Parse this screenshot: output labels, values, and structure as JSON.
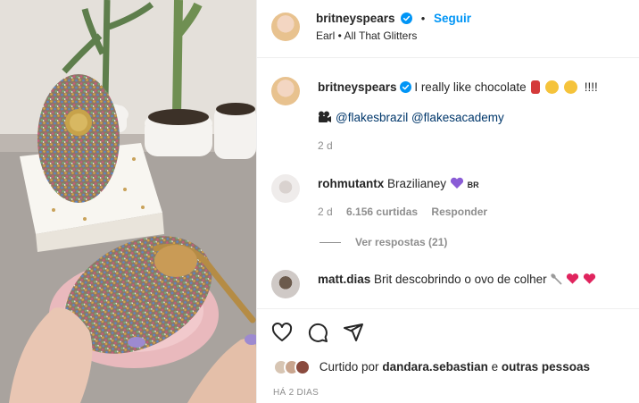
{
  "header": {
    "username": "britneyspears",
    "follow_label": "Seguir",
    "separator": "•",
    "subtitle": "Earl • All That Glitters"
  },
  "caption": {
    "username": "britneyspears",
    "text": "I really like chocolate",
    "text_suffix": "!!!!",
    "credit_mentions": "@flakesbrazil @flakesacademy",
    "time": "2 d"
  },
  "comments": [
    {
      "username": "rohmutantx",
      "text": "Brazilianey",
      "flag_text": "BR",
      "time": "2 d",
      "likes": "6.156 curtidas",
      "reply_label": "Responder",
      "view_replies": "Ver respostas (21)"
    },
    {
      "username": "matt.dias",
      "text": "Brit descobrindo o ovo de colher"
    }
  ],
  "likes_line": {
    "prefix": "Curtido por",
    "user": "dandara.sebastian",
    "joiner": "e",
    "others": "outras pessoas"
  },
  "post_date": "HÁ 2 DIAS",
  "colors": {
    "accent": "#0095f6",
    "verified": "#0095f6",
    "heart": "#ed4956",
    "mention": "#00376b",
    "muted": "#8e8e8e"
  },
  "icons": [
    "verified-badge-icon",
    "camera-icon",
    "heart-icon",
    "comment-icon",
    "share-icon",
    "purple-heart-icon"
  ]
}
